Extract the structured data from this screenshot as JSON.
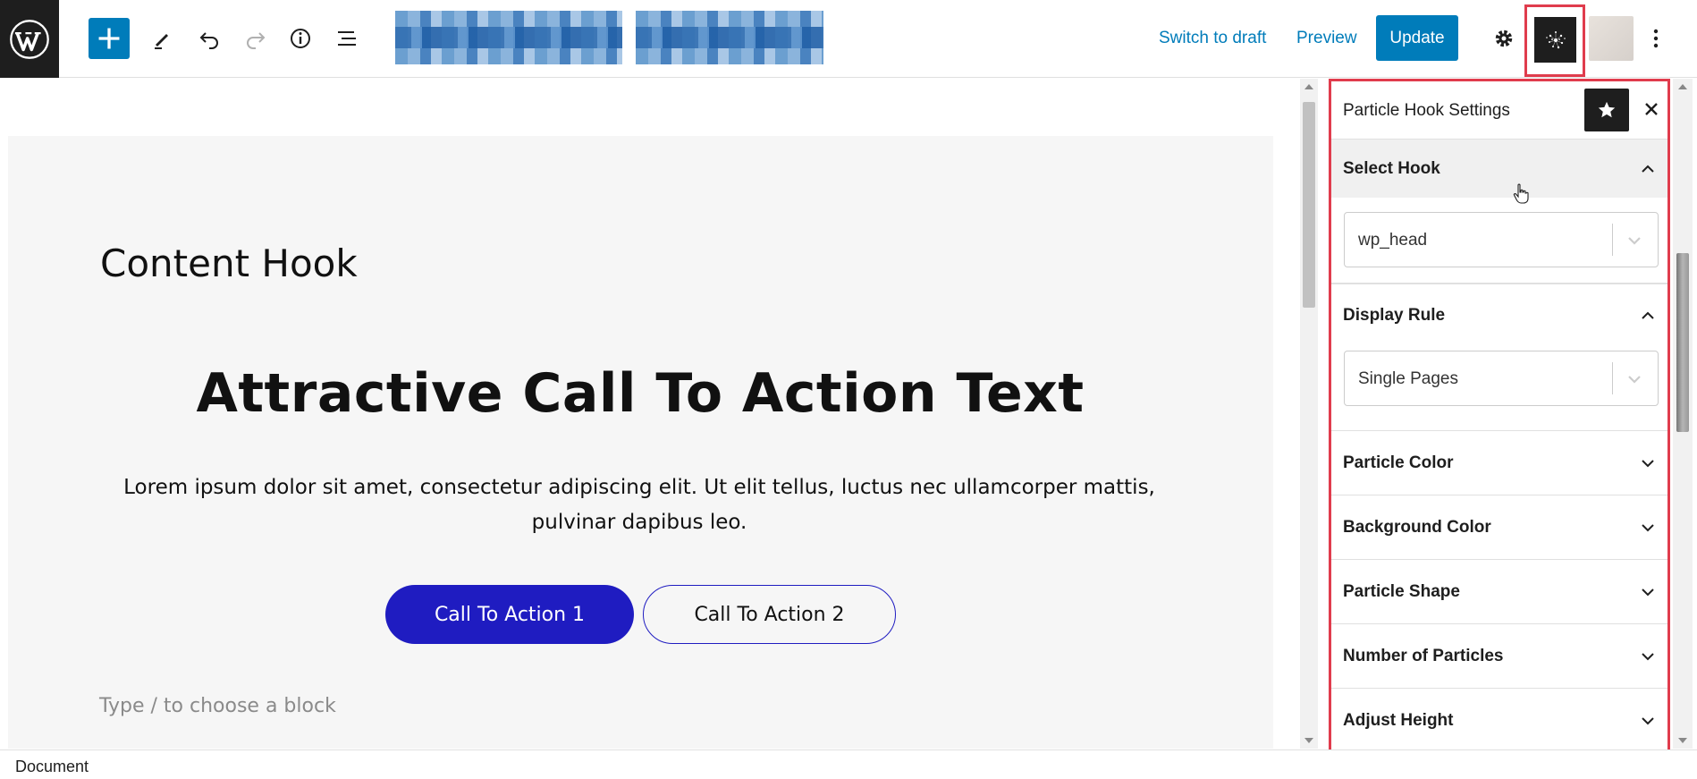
{
  "toolbar": {
    "logo_icon": "wordpress-logo",
    "add_block_icon": "plus-icon",
    "tools_icon": "pencil-icon",
    "undo_icon": "undo-icon",
    "redo_icon": "redo-icon",
    "info_icon": "info-icon",
    "list_view_icon": "list-view-icon",
    "switch_to_draft": "Switch to draft",
    "preview": "Preview",
    "update": "Update",
    "settings_icon": "gear-icon",
    "plugin_icon": "particle-hook-icon",
    "options_icon": "kebab-menu-icon"
  },
  "content": {
    "hook_title": "Content Hook",
    "heading": "Attractive Call To Action Text",
    "paragraph": "Lorem ipsum dolor sit amet, consectetur adipiscing elit. Ut elit tellus, luctus nec ullamcorper mattis, pulvinar dapibus leo.",
    "button_1": "Call To Action 1",
    "button_2": "Call To Action 2",
    "block_placeholder": "Type / to choose a block"
  },
  "sidebar": {
    "title": "Particle Hook Settings",
    "star_icon": "star-icon",
    "close_icon": "close-icon",
    "select_hook": {
      "label": "Select Hook",
      "value": "wp_head"
    },
    "display_rule": {
      "label": "Display Rule",
      "value": "Single Pages"
    },
    "panels": [
      {
        "label": "Particle Color"
      },
      {
        "label": "Background Color"
      },
      {
        "label": "Particle Shape"
      },
      {
        "label": "Number of Particles"
      },
      {
        "label": "Adjust Height"
      }
    ]
  },
  "footer": {
    "breadcrumb": "Document"
  },
  "colors": {
    "wp_blue": "#007cba",
    "cta_primary": "#1f1cc1",
    "highlight_red": "#e03c4d",
    "dark": "#1e1e1e"
  }
}
